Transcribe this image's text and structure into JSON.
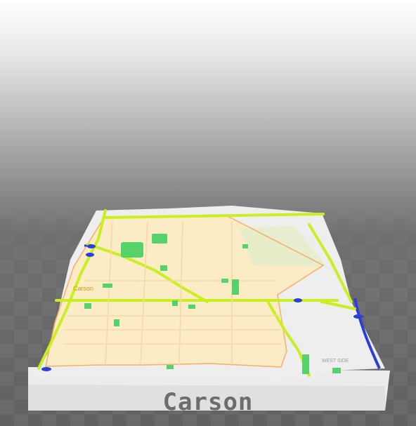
{
  "map": {
    "place_name": "Carson",
    "labels": {
      "city": "Carson",
      "district": "WEST SIDE"
    },
    "colors": {
      "city_fill": "#fdebc1",
      "outside_fill": "#eeeeee",
      "park": "#55d26a",
      "highway": "#c9ef22",
      "water": "#2a3fd6",
      "boundary": "#f6ae69",
      "base_side": "#ececec"
    }
  }
}
